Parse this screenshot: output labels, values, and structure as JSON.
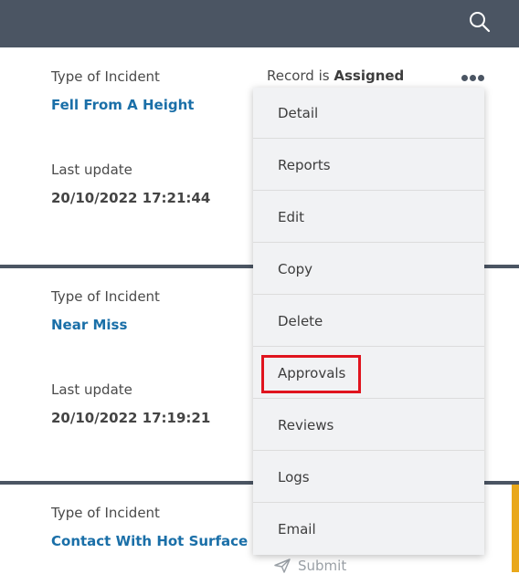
{
  "header": {
    "search_icon": "search-icon"
  },
  "incidents": [
    {
      "type_label": "Type of Incident",
      "type_value": "Fell From A Height",
      "update_label": "Last update",
      "update_value": "20/10/2022 17:21:44"
    },
    {
      "type_label": "Type of Incident",
      "type_value": "Near Miss",
      "update_label": "Last update",
      "update_value": "20/10/2022 17:19:21"
    },
    {
      "type_label": "Type of Incident",
      "type_value": "Contact With Hot Surface"
    }
  ],
  "record_status": {
    "prefix": "Record is",
    "value": "Assigned"
  },
  "menu": {
    "items": [
      {
        "label": "Detail"
      },
      {
        "label": "Reports"
      },
      {
        "label": "Edit"
      },
      {
        "label": "Copy"
      },
      {
        "label": "Delete"
      },
      {
        "label": "Approvals"
      },
      {
        "label": "Reviews"
      },
      {
        "label": "Logs"
      },
      {
        "label": "Email"
      }
    ]
  },
  "submit_label": "Submit",
  "colors": {
    "header": "#4b5563",
    "link": "#1a6fa8",
    "highlight": "#e0141e",
    "accent": "#e9a81b"
  }
}
